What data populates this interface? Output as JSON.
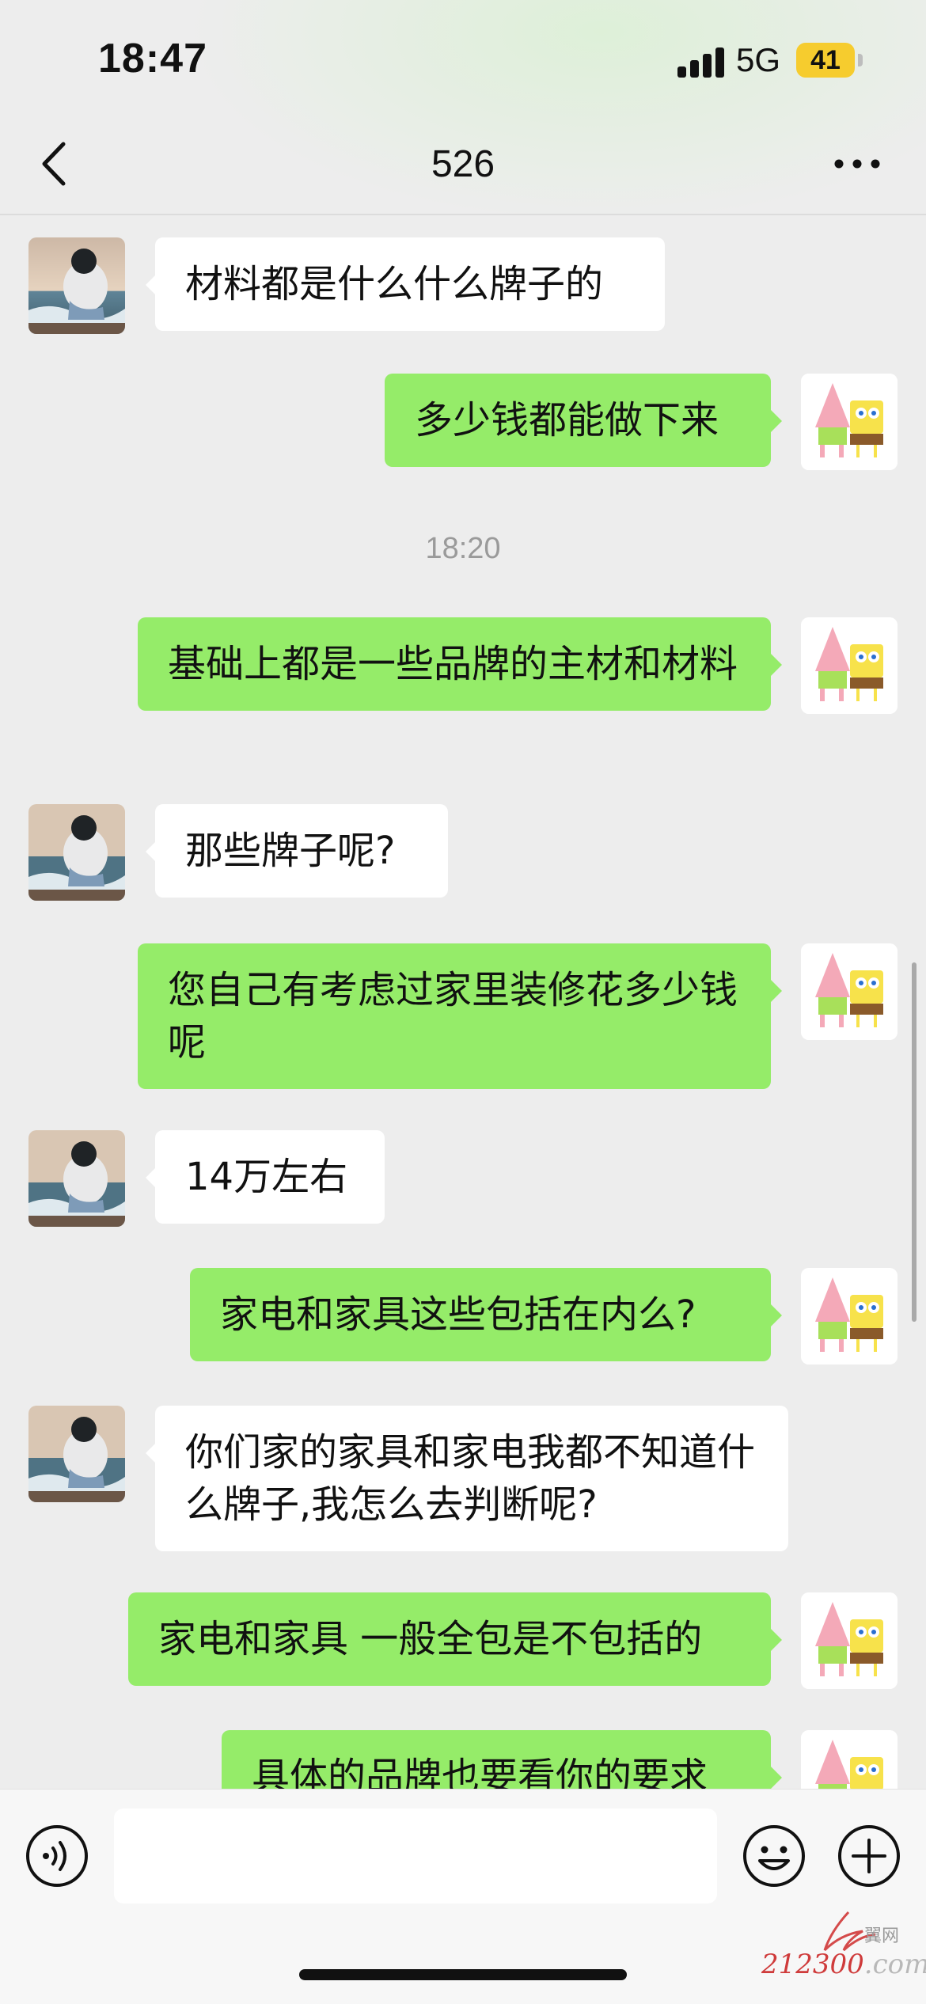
{
  "status_bar": {
    "time": "18:47",
    "network": "5G",
    "battery": "41"
  },
  "nav": {
    "title": "526"
  },
  "messages": [
    {
      "side": "left",
      "text": "材料都是什么什么牌子的"
    },
    {
      "side": "right",
      "text": "多少钱都能做下来"
    },
    {
      "type": "time",
      "text": "18:20"
    },
    {
      "side": "right",
      "text": "基础上都是一些品牌的主材和材料"
    },
    {
      "side": "left",
      "text": "那些牌子呢?"
    },
    {
      "side": "right",
      "text": "您自己有考虑过家里装修花多少钱呢"
    },
    {
      "side": "left",
      "text": "14万左右"
    },
    {
      "side": "right",
      "text": "家电和家具这些包括在内么?"
    },
    {
      "side": "left",
      "text": "你们家的家具和家电我都不知道什么牌子,我怎么去判断呢?"
    },
    {
      "side": "right",
      "text": "家电和家具 一般全包是不包括的"
    },
    {
      "side": "right",
      "text": "具体的品牌也要看你的要求"
    }
  ],
  "input": {
    "value": ""
  },
  "watermark": {
    "cn": "翼网",
    "url_prefix": "212300",
    "url_suffix": ".com"
  },
  "colors": {
    "background": "#ededed",
    "bubble_self": "#95ec69",
    "bubble_other": "#ffffff",
    "battery": "#f6cc2e"
  }
}
